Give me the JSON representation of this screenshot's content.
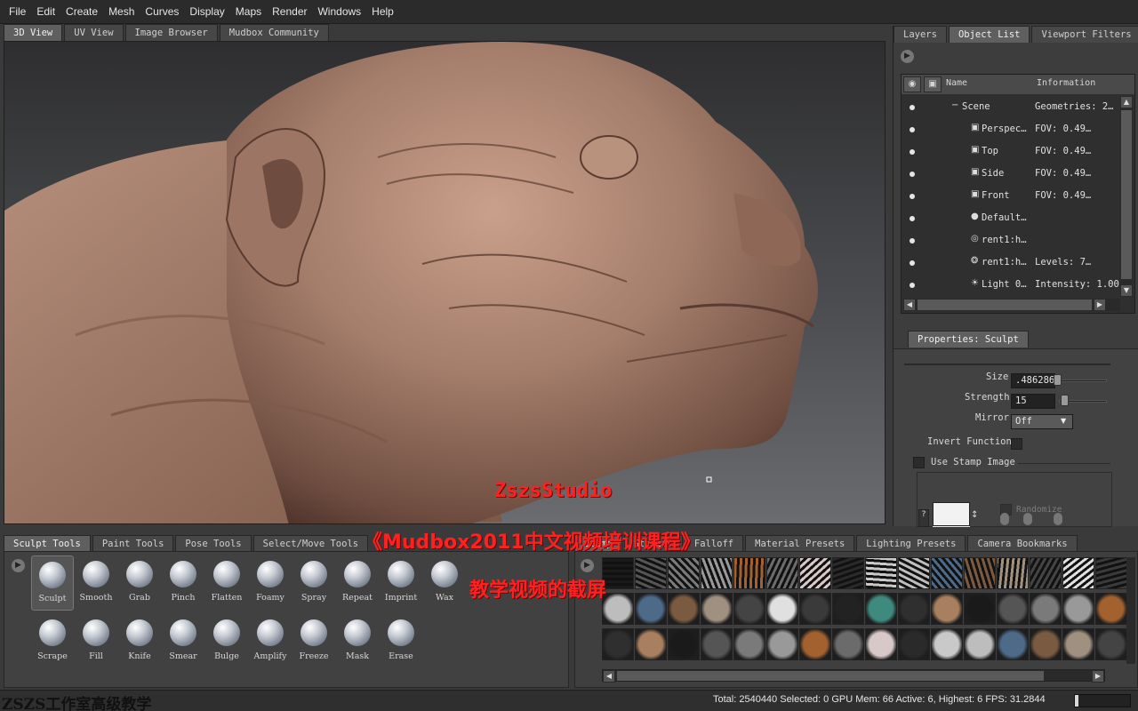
{
  "menu": [
    "File",
    "Edit",
    "Create",
    "Mesh",
    "Curves",
    "Display",
    "Maps",
    "Render",
    "Windows",
    "Help"
  ],
  "view_tabs": [
    "3D View",
    "UV View",
    "Image Browser",
    "Mudbox Community"
  ],
  "right_tabs": [
    "Layers",
    "Object List",
    "Viewport Filters"
  ],
  "object_list": {
    "col_name": "Name",
    "col_info": "Information",
    "rows": [
      {
        "name": "Scene",
        "info": "Geometries: 2…",
        "icon": "scene-node"
      },
      {
        "name": "Perspec…",
        "info": "FOV: 0.49…",
        "icon": "camera-icon"
      },
      {
        "name": "Top",
        "info": "FOV: 0.49…",
        "icon": "camera-icon"
      },
      {
        "name": "Side",
        "info": "FOV: 0.49…",
        "icon": "camera-icon"
      },
      {
        "name": "Front",
        "info": "FOV: 0.49…",
        "icon": "camera-icon"
      },
      {
        "name": "Default…",
        "info": "",
        "icon": "material-icon"
      },
      {
        "name": "rent1:h…",
        "info": "",
        "icon": "mesh-icon"
      },
      {
        "name": "rent1:h…",
        "info": "Levels: 7…",
        "icon": "mesh-levels-icon"
      },
      {
        "name": "Light 0…",
        "info": "Intensity: 1.00",
        "icon": "light-icon"
      }
    ]
  },
  "properties": {
    "tab": "Properties: Sculpt",
    "size_label": "Size",
    "size_value": ".486286",
    "strength_label": "Strength",
    "strength_value": "15",
    "mirror_label": "Mirror",
    "mirror_value": "Off",
    "invert_label": "Invert Function",
    "stamp_label": "Use Stamp Image",
    "randomize_label": "Randomize"
  },
  "bottom_tabs_left": [
    "Sculpt Tools",
    "Paint Tools",
    "Pose Tools",
    "Select/Move Tools"
  ],
  "bottom_tabs_right": [
    "Stamp",
    "Stencil",
    "Falloff",
    "Material Presets",
    "Lighting Presets",
    "Camera Bookmarks"
  ],
  "tools_row1": [
    "Sculpt",
    "Smooth",
    "Grab",
    "Pinch",
    "Flatten",
    "Foamy",
    "Spray",
    "Repeat",
    "Imprint",
    "Wax"
  ],
  "tools_row2": [
    "Scrape",
    "Fill",
    "Knife",
    "Smear",
    "Bulge",
    "Amplify",
    "Freeze",
    "Mask",
    "Erase"
  ],
  "status": "Total: 2540440  Selected: 0 GPU Mem: 66  Active: 6, Highest: 6  FPS: 31.2844",
  "watermarks": {
    "studio": "ZszsStudio",
    "course": "《Mudbox2011中文视频培训课程》",
    "caption": "教学视频的截屏",
    "footer": "ZSZS工作室高级教学"
  },
  "colors": {
    "skin": "#a47d6b",
    "accent_red": "#ff2020"
  }
}
